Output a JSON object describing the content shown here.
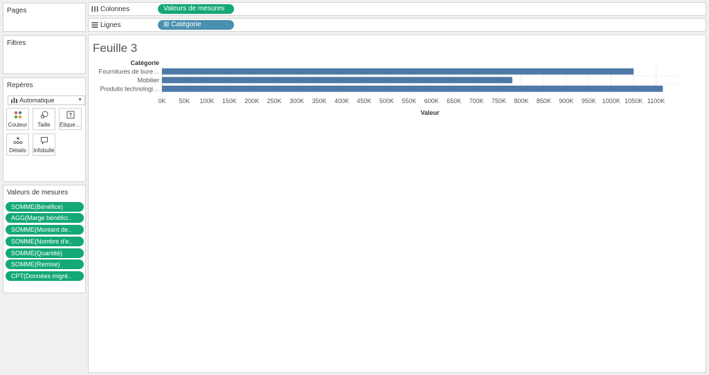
{
  "side": {
    "pages_title": "Pages",
    "filters_title": "Filtres",
    "marks_title": "Repères",
    "marks_type": "Automatique",
    "mark_buttons": [
      {
        "label": "Couleur",
        "icon": "color-icon"
      },
      {
        "label": "Taille",
        "icon": "size-icon"
      },
      {
        "label": "Étique…",
        "icon": "label-icon"
      },
      {
        "label": "Détails",
        "icon": "detail-icon"
      },
      {
        "label": "Infobulle",
        "icon": "tooltip-icon"
      }
    ],
    "measures_title": "Valeurs de mesures",
    "measures": [
      "SOMME(Bénéfice)",
      "AGG(Marge bénéfici..",
      "SOMME(Montant de..",
      "SOMME(Nombre d'e..",
      "SOMME(Quantité)",
      "SOMME(Remise)",
      "CPT(Données migré.."
    ]
  },
  "shelves": {
    "columns_label": "Colonnes",
    "columns_pill": "Valeurs de mesures",
    "rows_label": "Lignes",
    "rows_pill": "⊞ Catégorie"
  },
  "sheet": {
    "title": "Feuille 3"
  },
  "colors": {
    "bar": "#4e79a7",
    "pill_measure": "#14a874",
    "pill_dimension": "#4a90b0"
  },
  "chart_data": {
    "type": "bar",
    "orientation": "horizontal",
    "category_header": "Catégorie",
    "categories": [
      "Fournitures de bure…",
      "Mobilier",
      "Produits technologi…"
    ],
    "values": [
      1050000,
      780000,
      1115000
    ],
    "xlabel": "Valeur",
    "xlim": [
      0,
      1150000
    ],
    "ticks": [
      0,
      50000,
      100000,
      150000,
      200000,
      250000,
      300000,
      350000,
      400000,
      450000,
      500000,
      550000,
      600000,
      650000,
      700000,
      750000,
      800000,
      850000,
      900000,
      950000,
      1000000,
      1050000,
      1100000
    ],
    "tick_labels": [
      "0K",
      "50K",
      "100K",
      "150K",
      "200K",
      "250K",
      "300K",
      "350K",
      "400K",
      "450K",
      "500K",
      "550K",
      "600K",
      "650K",
      "700K",
      "750K",
      "800K",
      "850K",
      "900K",
      "950K",
      "1000K",
      "1050K",
      "1100K"
    ],
    "grid": true
  }
}
